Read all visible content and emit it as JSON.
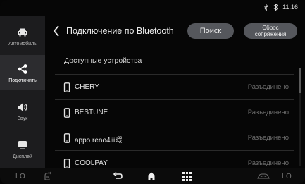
{
  "status": {
    "time": "11:16",
    "icons": [
      "usb-icon",
      "bluetooth-icon"
    ]
  },
  "sidebar": {
    "items": [
      {
        "label": "Автомобиль",
        "icon": "car-icon"
      },
      {
        "label": "Подключить",
        "icon": "share-icon",
        "active": true
      },
      {
        "label": "Звук",
        "icon": "speaker-icon"
      },
      {
        "label": "Дисплей",
        "icon": "display-icon"
      }
    ]
  },
  "header": {
    "title": "Подключение по Bluetooth",
    "search_label": "Поиск",
    "reset_label_line1": "Сброс",
    "reset_label_line2": "сопряжения"
  },
  "section_title": "Доступные устройства",
  "devices": [
    {
      "name": "CHERY",
      "status": "Разъединено"
    },
    {
      "name": "BESTUNE",
      "status": "Разъединено"
    },
    {
      "name": "appo reno4iii暇",
      "status": "Разъединено"
    },
    {
      "name": "COOLPAY",
      "status": "Разъединено"
    }
  ],
  "bottom": {
    "left_temp": "LO",
    "right_temp": "LO"
  },
  "colors": {
    "accent": "#4aa3ff",
    "button": "#55575c",
    "sidebar_bg": "#1c1c1e",
    "status_muted": "#6e6e6e"
  }
}
